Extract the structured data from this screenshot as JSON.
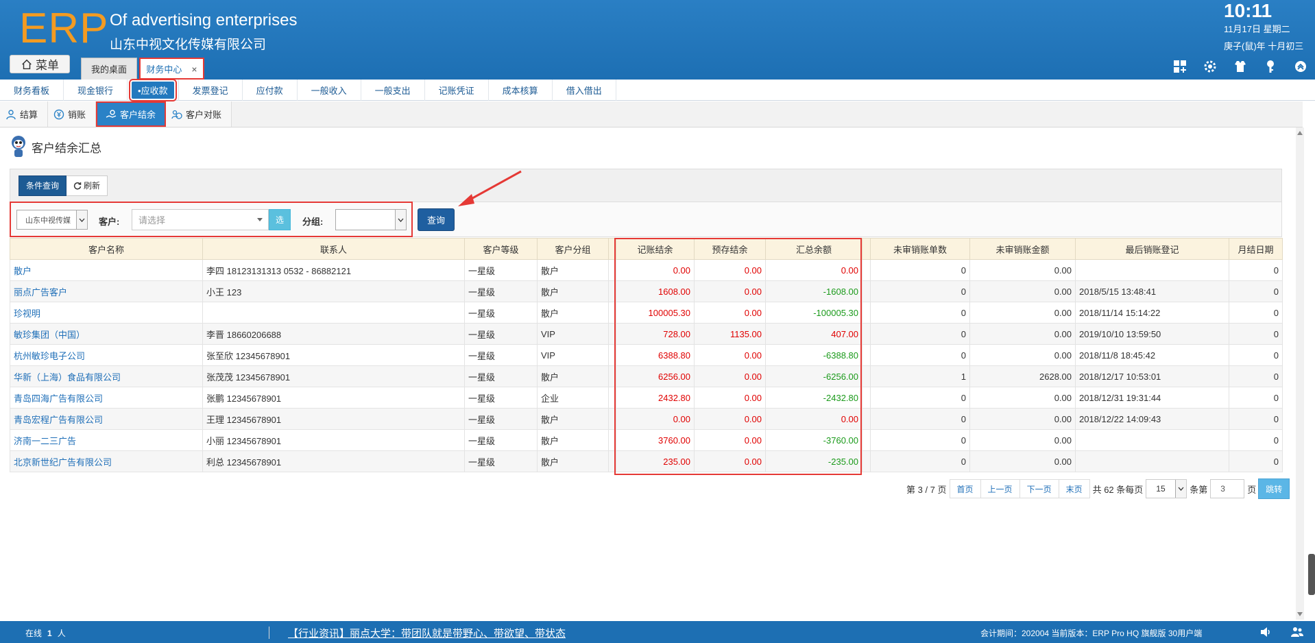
{
  "header": {
    "logo": "ERP",
    "company_en": "Of advertising enterprises",
    "company_cn": "山东中视文化传媒有限公司",
    "time": "10:11",
    "date": "11月17日 星期二",
    "lunar": "庚子(鼠)年 十月初三",
    "menu_label": "菜单",
    "tabs": [
      {
        "label": "我的桌面"
      },
      {
        "label": "财务中心",
        "close": "×"
      }
    ]
  },
  "modules": [
    "财务看板",
    "现金银行",
    "•应收款",
    "发票登记",
    "应付款",
    "一般收入",
    "一般支出",
    "记账凭证",
    "成本核算",
    "借入借出"
  ],
  "subtabs": [
    "结算",
    "销账",
    "客户结余",
    "客户对账"
  ],
  "page_title": "客户结余汇总",
  "toolbar": {
    "cond_query": "条件查询",
    "refresh": "刷新"
  },
  "filter": {
    "company_value": "山东中视传媒",
    "customer_label": "客户:",
    "customer_placeholder": "请选择",
    "select_btn": "选",
    "group_label": "分组:",
    "query_btn": "查询"
  },
  "table": {
    "headers": [
      "客户名称",
      "联系人",
      "客户等级",
      "客户分组",
      "",
      "记账结余",
      "预存结余",
      "汇总余额",
      "",
      "未审销账单数",
      "未审销账金额",
      "最后销账登记",
      "月结日期"
    ],
    "rows": [
      [
        "散户",
        "李四 18123131313 0532 - 86882121",
        "一星级",
        "散户",
        "",
        "0.00",
        "0.00",
        "0.00",
        "",
        "0",
        "0.00",
        "",
        "0"
      ],
      [
        "丽点广告客户",
        "小王 123",
        "一星级",
        "散户",
        "",
        "1608.00",
        "0.00",
        "-1608.00",
        "",
        "0",
        "0.00",
        "2018/5/15 13:48:41",
        "0"
      ],
      [
        "珍视明",
        "",
        "一星级",
        "散户",
        "",
        "100005.30",
        "0.00",
        "-100005.30",
        "",
        "0",
        "0.00",
        "2018/11/14 15:14:22",
        "0"
      ],
      [
        "敏珍集团（中国）",
        "李晋 18660206688",
        "一星级",
        "VIP",
        "",
        "728.00",
        "1135.00",
        "407.00",
        "",
        "0",
        "0.00",
        "2019/10/10 13:59:50",
        "0"
      ],
      [
        "杭州敏珍电子公司",
        "张至欣 12345678901",
        "一星级",
        "VIP",
        "",
        "6388.80",
        "0.00",
        "-6388.80",
        "",
        "0",
        "0.00",
        "2018/11/8 18:45:42",
        "0"
      ],
      [
        "华新（上海）食品有限公司",
        "张茂茂 12345678901",
        "一星级",
        "散户",
        "",
        "6256.00",
        "0.00",
        "-6256.00",
        "",
        "1",
        "2628.00",
        "2018/12/17 10:53:01",
        "0"
      ],
      [
        "青岛四海广告有限公司",
        "张鹏 12345678901",
        "一星级",
        "企业",
        "",
        "2432.80",
        "0.00",
        "-2432.80",
        "",
        "0",
        "0.00",
        "2018/12/31 19:31:44",
        "0"
      ],
      [
        "青岛宏程广告有限公司",
        "王理 12345678901",
        "一星级",
        "散户",
        "",
        "0.00",
        "0.00",
        "0.00",
        "",
        "0",
        "0.00",
        "2018/12/22 14:09:43",
        "0"
      ],
      [
        "济南一二三广告",
        "小丽 12345678901",
        "一星级",
        "散户",
        "",
        "3760.00",
        "0.00",
        "-3760.00",
        "",
        "0",
        "0.00",
        "",
        "0"
      ],
      [
        "北京新世纪广告有限公司",
        "利总 12345678901",
        "一星级",
        "散户",
        "",
        "235.00",
        "0.00",
        "-235.00",
        "",
        "0",
        "0.00",
        "",
        "0"
      ]
    ]
  },
  "pager": {
    "page_info": "第 3 / 7 页",
    "first": "首页",
    "prev": "上一页",
    "next": "下一页",
    "last": "末页",
    "total": "共 62 条每页",
    "page_size": "15",
    "goto_prefix": "条第",
    "goto_value": "3",
    "goto_suffix": "页",
    "jump": "跳转"
  },
  "footer": {
    "online_prefix": "在线",
    "online_count": "1",
    "online_suffix": "人",
    "news": "【行业资讯】丽点大学：带团队就是带野心、带欲望、带状态",
    "version": "会计期间：202004 当前版本：ERP Pro HQ 旗舰版 30用户端"
  },
  "colors": {
    "header_blue": "#1d6fb3",
    "accent_orange": "#f39b22",
    "highlight_red": "#e53935",
    "negative_green": "#1a9a1a",
    "value_red": "#e00000"
  }
}
